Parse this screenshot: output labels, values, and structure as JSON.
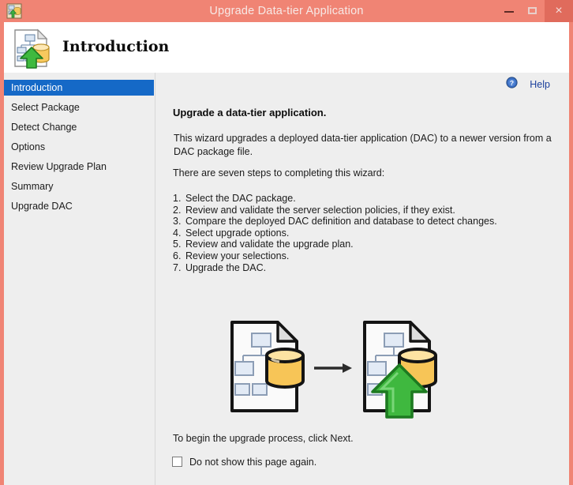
{
  "window": {
    "title": "Upgrade Data-tier Application",
    "app_icon": "dac-upgrade-icon",
    "controls": {
      "minimize": "–",
      "maximize": "☐",
      "close": "×"
    },
    "colors": {
      "titlebar": "#F08474",
      "accent_border": "#F08474",
      "selection": "#1569C7",
      "panel_bg": "#eeeeee",
      "header_bg": "#ffffff",
      "link": "#1b3f9c"
    }
  },
  "header": {
    "title": "Introduction",
    "icon": "dac-package-database-upgrade-icon"
  },
  "sidebar": {
    "items": [
      {
        "label": "Introduction",
        "selected": true
      },
      {
        "label": "Select Package",
        "selected": false
      },
      {
        "label": "Detect Change",
        "selected": false
      },
      {
        "label": "Options",
        "selected": false
      },
      {
        "label": "Review Upgrade Plan",
        "selected": false
      },
      {
        "label": "Summary",
        "selected": false
      },
      {
        "label": "Upgrade DAC",
        "selected": false
      }
    ]
  },
  "main": {
    "help": {
      "label": "Help",
      "icon": "help-circle-icon"
    },
    "heading": "Upgrade a data-tier application.",
    "paragraph": "This wizard upgrades a deployed data-tier application (DAC) to a newer version from a DAC package file.",
    "steps_intro": "There are seven steps to completing this wizard:",
    "steps": [
      {
        "num": "1.",
        "text": "Select the DAC package."
      },
      {
        "num": "2.",
        "text": "Review and validate the server selection policies, if they exist."
      },
      {
        "num": "3.",
        "text": "Compare the deployed DAC definition and database to detect changes."
      },
      {
        "num": "4.",
        "text": "Select upgrade options."
      },
      {
        "num": "5.",
        "text": "Review and validate the upgrade plan."
      },
      {
        "num": "6.",
        "text": "Review your selections."
      },
      {
        "num": "7.",
        "text": "Upgrade the DAC."
      }
    ],
    "illustration": {
      "left_icon": "dac-package-database-icon",
      "arrow": "right-arrow-icon",
      "right_icon": "dac-package-database-upgrade-icon"
    },
    "footer_note": "To begin the upgrade process, click Next.",
    "dont_show": {
      "label": "Do not show this page again.",
      "checked": false
    }
  }
}
